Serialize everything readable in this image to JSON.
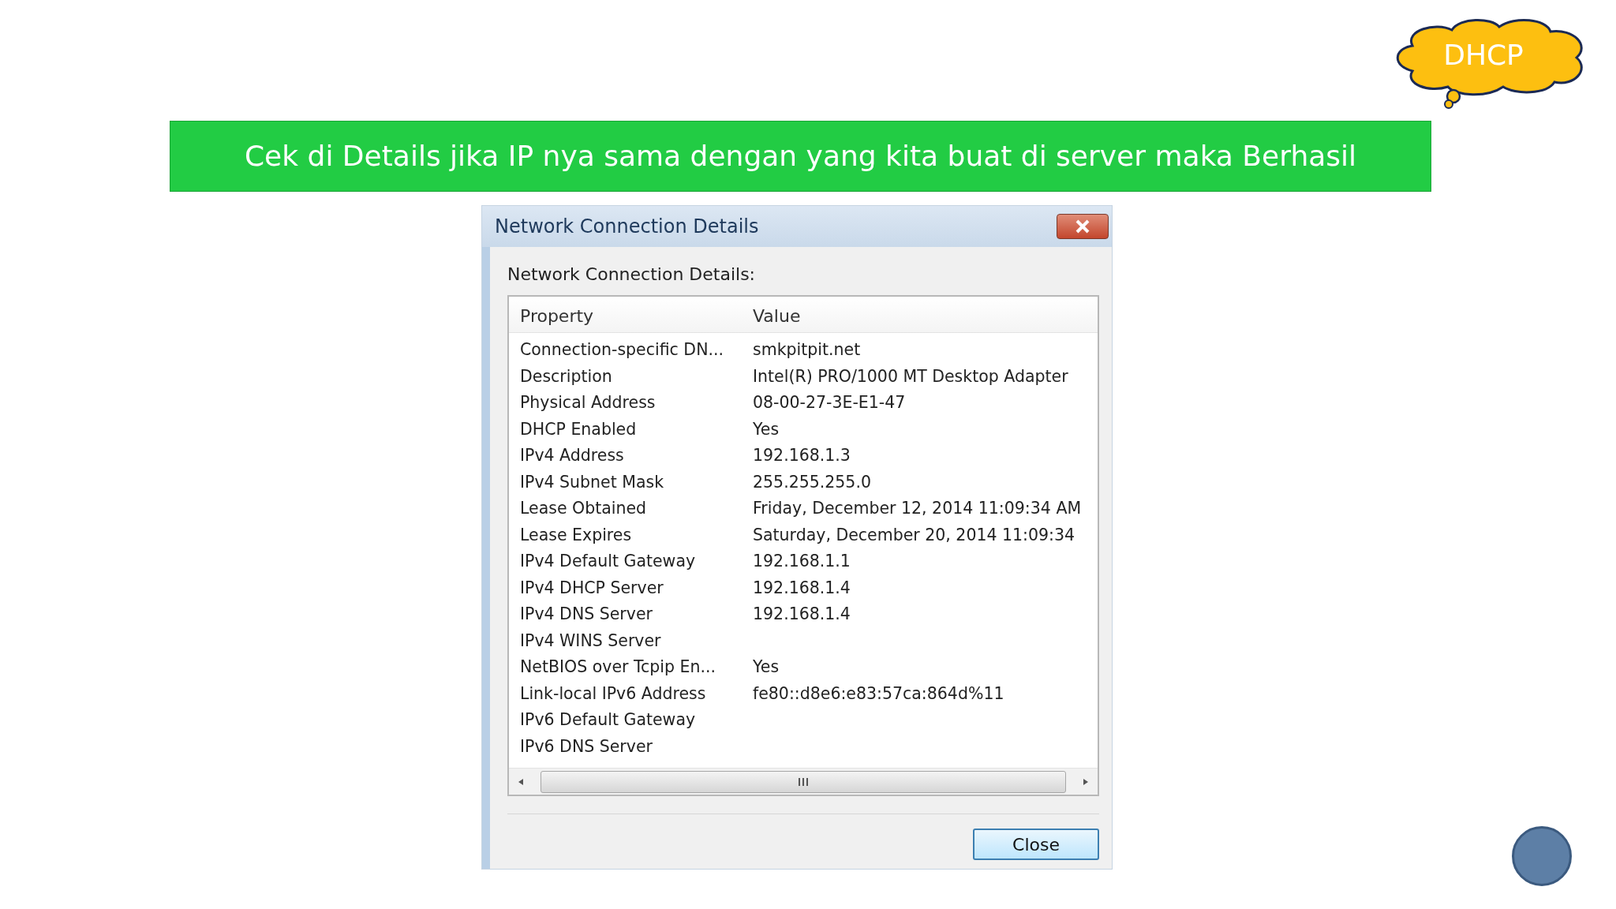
{
  "slide": {
    "banner": "Cek di Details jika IP nya sama dengan yang kita buat di server maka Berhasil",
    "callout": "DHCP"
  },
  "window": {
    "title": "Network Connection Details",
    "caption": "Network Connection Details:",
    "table": {
      "columns": [
        "Property",
        "Value"
      ],
      "rows": [
        [
          "Connection-specific DN...",
          "smkpitpit.net"
        ],
        [
          "Description",
          "Intel(R) PRO/1000 MT Desktop Adapter"
        ],
        [
          "Physical Address",
          "08-00-27-3E-E1-47"
        ],
        [
          "DHCP Enabled",
          "Yes"
        ],
        [
          "IPv4 Address",
          "192.168.1.3"
        ],
        [
          "IPv4 Subnet Mask",
          "255.255.255.0"
        ],
        [
          "Lease Obtained",
          "Friday, December 12, 2014 11:09:34 AM"
        ],
        [
          "Lease Expires",
          "Saturday, December 20, 2014 11:09:34"
        ],
        [
          "IPv4 Default Gateway",
          "192.168.1.1"
        ],
        [
          "IPv4 DHCP Server",
          "192.168.1.4"
        ],
        [
          "IPv4 DNS Server",
          "192.168.1.4"
        ],
        [
          "IPv4 WINS Server",
          ""
        ],
        [
          "NetBIOS over Tcpip En...",
          "Yes"
        ],
        [
          "Link-local IPv6 Address",
          "fe80::d8e6:e83:57ca:864d%11"
        ],
        [
          "IPv6 Default Gateway",
          ""
        ],
        [
          "IPv6 DNS Server",
          ""
        ]
      ]
    },
    "buttons": [
      "Close"
    ]
  }
}
